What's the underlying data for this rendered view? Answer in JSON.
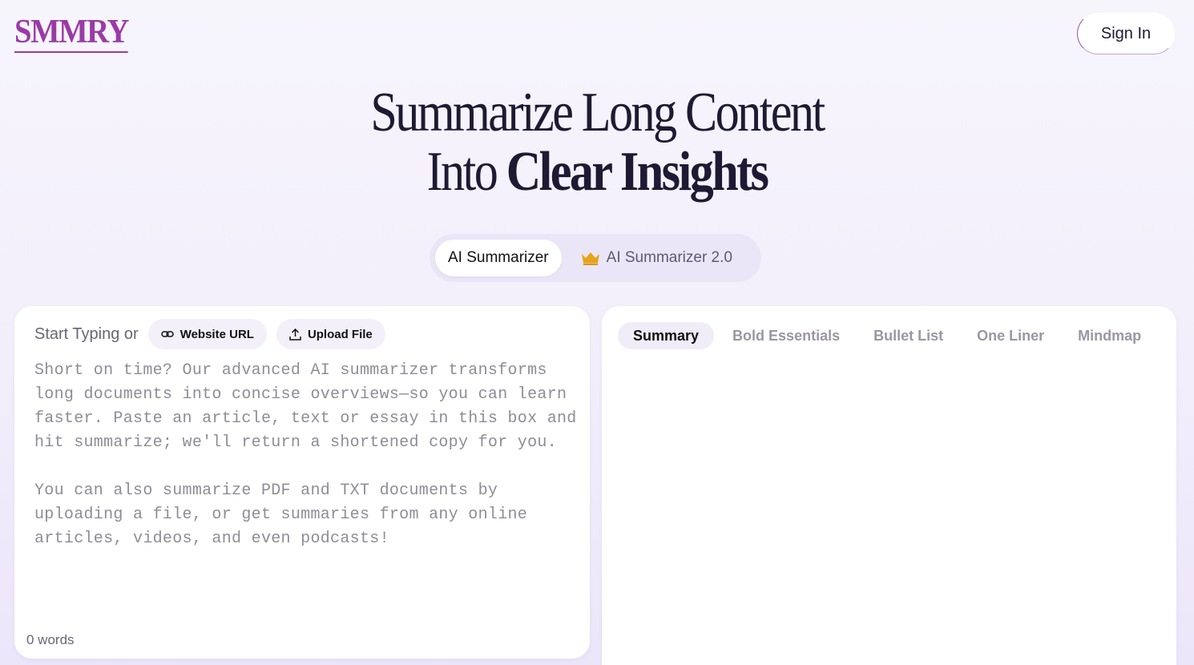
{
  "header": {
    "logo": "SMMRY",
    "sign_in": "Sign In"
  },
  "hero": {
    "line1": "Summarize Long Content",
    "line2_plain": "Into ",
    "line2_strong": "Clear Insights"
  },
  "modes": {
    "active": "AI Summarizer",
    "premium": "AI Summarizer 2.0",
    "premium_icon": "crown-icon",
    "crown_color": "#e8a317"
  },
  "input_panel": {
    "start_label": "Start Typing or",
    "website_url": "Website URL",
    "upload_file": "Upload File",
    "placeholder": "Short on time? Our advanced AI summarizer transforms\nlong documents into concise overviews—so you can learn\nfaster. Paste an article, text or essay in this box and\nhit summarize; we'll return a shortened copy for you.\n\nYou can also summarize PDF and TXT documents by\nuploading a file, or get summaries from any online\narticles, videos, and even podcasts!",
    "word_count": "0 words"
  },
  "output_panel": {
    "tabs": [
      {
        "label": "Summary",
        "active": true
      },
      {
        "label": "Bold Essentials",
        "active": false
      },
      {
        "label": "Bullet List",
        "active": false
      },
      {
        "label": "One Liner",
        "active": false
      },
      {
        "label": "Mindmap",
        "active": false
      }
    ]
  },
  "colors": {
    "brand": "#9a3aa6",
    "text": "#1f1a33"
  }
}
